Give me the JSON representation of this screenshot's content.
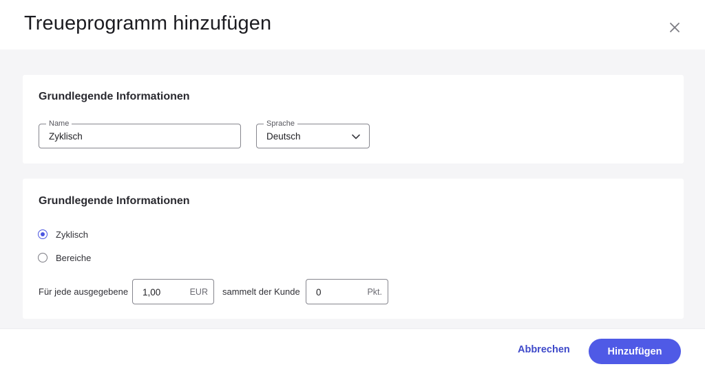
{
  "dialog": {
    "title": "Treueprogramm hinzufügen",
    "close_icon": "close-icon"
  },
  "section_basic": {
    "title": "Grundlegende Informationen",
    "name_field": {
      "label": "Name",
      "value": "Zyklisch"
    },
    "language_field": {
      "label": "Sprache",
      "value": "Deutsch",
      "icon": "chevron-down-icon"
    }
  },
  "section_type": {
    "title": "Grundlegende Informationen",
    "options": [
      {
        "label": "Zyklisch",
        "checked": true
      },
      {
        "label": "Bereiche",
        "checked": false
      }
    ],
    "rule": {
      "prefix": "Für jede ausgegebene",
      "amount_value": "1,00",
      "amount_unit": "EUR",
      "middle": "sammelt der Kunde",
      "points_value": "0",
      "points_unit": "Pkt."
    }
  },
  "footer": {
    "cancel_label": "Abbrechen",
    "submit_label": "Hinzufügen"
  },
  "colors": {
    "accent": "#4f5ae6",
    "link": "#3e49c9",
    "background": "#f5f5f7"
  }
}
